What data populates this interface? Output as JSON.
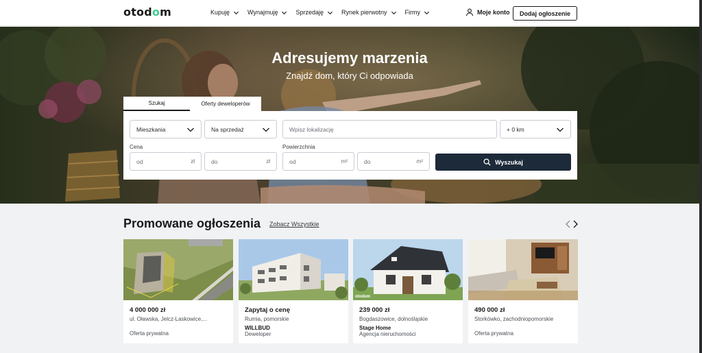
{
  "header": {
    "logo_parts": [
      "otod",
      "o",
      "m"
    ],
    "nav": [
      "Kupuję",
      "Wynajmuję",
      "Sprzedaję",
      "Rynek pierwotny",
      "Firmy"
    ],
    "account_label": "Moje konto",
    "add_listing_label": "Dodaj ogłoszenie"
  },
  "hero": {
    "title": "Adresujemy marzenia",
    "subtitle": "Znajdź dom, który Ci odpowiada"
  },
  "search": {
    "tabs": [
      "Szukaj",
      "Oferty deweloperów"
    ],
    "active_tab": "Szukaj",
    "property_type": "Mieszkania",
    "transaction": "Na sprzedaż",
    "location_placeholder": "Wpisz lokalizację",
    "radius": "+ 0 km",
    "price_label": "Cena",
    "price_from": "od",
    "price_to": "do",
    "price_unit": "zł",
    "area_label": "Powierzchnia",
    "area_from": "od",
    "area_to": "do",
    "area_unit": "m²",
    "submit_label": "Wyszukaj"
  },
  "promoted": {
    "title": "Promowane ogłoszenia",
    "see_all": "Zobacz Wszystkie",
    "listings": [
      {
        "price": "4 000 000 zł",
        "location": "ul. Oławska, Jelcz-Laskowice,...",
        "agency": "",
        "type": "Oferta prywatna"
      },
      {
        "price": "Zapytaj o cenę",
        "location": "Rumia, pomorskie",
        "agency": "WILLBUD",
        "type": "Deweloper"
      },
      {
        "price": "239 000 zł",
        "location": "Bogdaszowice, dolnośląskie",
        "agency": "Stage Home",
        "type": "Agencja nieruchomości",
        "watermark": "otodom"
      },
      {
        "price": "490 000 zł",
        "location": "Storkówko, zachodniopomorskie",
        "agency": "",
        "type": "Oferta prywatna"
      }
    ]
  },
  "colors": {
    "brand_accent": "#3ecf8e",
    "search_button": "#1c2a3a",
    "page_bg": "#f1f2f4"
  }
}
